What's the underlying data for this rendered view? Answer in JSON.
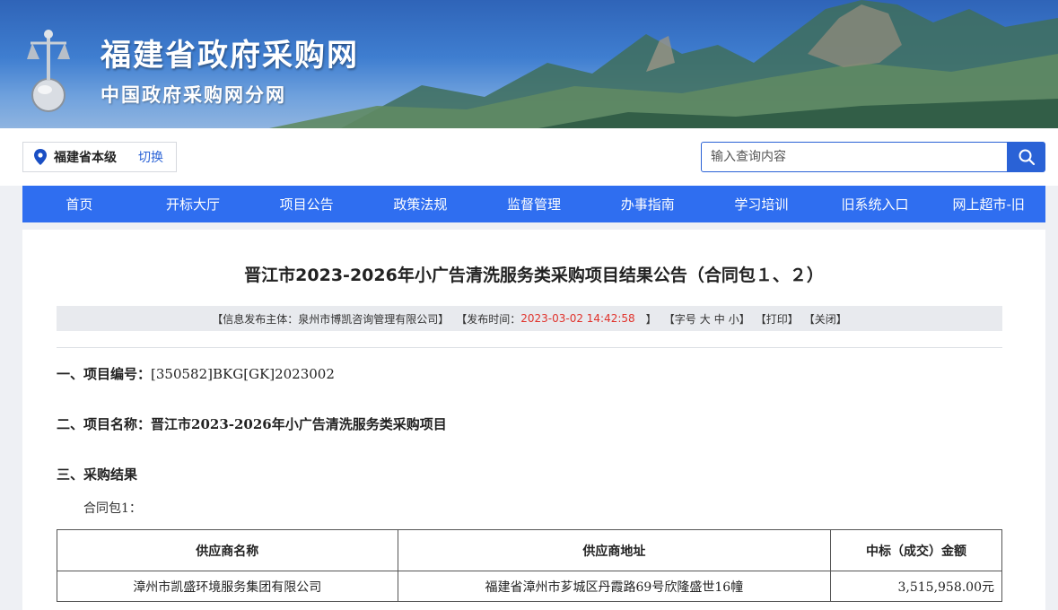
{
  "banner": {
    "title": "福建省政府采购网",
    "subtitle": "中国政府采购网分网"
  },
  "region": {
    "name": "福建省本级",
    "switch_label": "切换"
  },
  "search": {
    "placeholder": "输入查询内容"
  },
  "nav": {
    "items": [
      "首页",
      "开标大厅",
      "项目公告",
      "政策法规",
      "监督管理",
      "办事指南",
      "学习培训",
      "旧系统入口",
      "网上超市-旧"
    ]
  },
  "article": {
    "title": "晋江市2023-2026年小广告清洗服务类采购项目结果公告（合同包１、２）",
    "meta": {
      "publisher": "【信息发布主体：泉州市博凯咨询管理有限公司】",
      "time_label": "【发布时间：",
      "time_value": "2023-03-02 14:42:58",
      "time_close": "】",
      "font_label": "【字号",
      "font_large": "大",
      "font_medium": "中",
      "font_small": "小",
      "font_close": "】",
      "print": "【打印】",
      "close": "【关闭】"
    },
    "sections": {
      "project_no_label": "一、项目编号：",
      "project_no": "[350582]BKG[GK]2023002",
      "project_name_label": "二、项目名称：",
      "project_name": "晋江市2023-2026年小广告清洗服务类采购项目",
      "result_label": "三、采购结果"
    },
    "package_label": "合同包1：",
    "table": {
      "headers": [
        "供应商名称",
        "供应商地址",
        "中标（成交）金额"
      ],
      "rows": [
        [
          "漳州市凯盛环境服务集团有限公司",
          "福建省漳州市芗城区丹霞路69号欣隆盛世16幢",
          "3,515,958.00元"
        ]
      ]
    }
  },
  "colors": {
    "nav_bg": "#2f6ef0",
    "accent": "#2a62d6",
    "time_red": "#e0322b"
  }
}
